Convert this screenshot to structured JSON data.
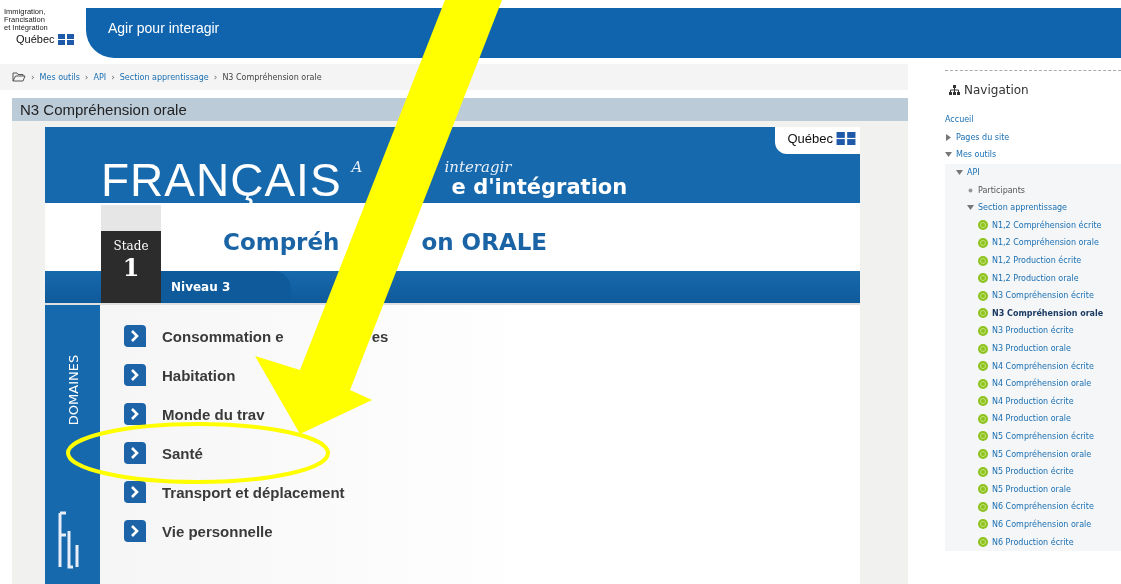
{
  "header": {
    "logo_lines": [
      "Immigration,",
      "Francisation",
      "et Intégration"
    ],
    "logo_name": "Québec",
    "site_title": "Agir pour interagir"
  },
  "breadcrumb": {
    "separator": "›",
    "items": [
      "Mes outils",
      "API",
      "Section apprentissage",
      "N3 Compréhension orale"
    ]
  },
  "page_title": "N3 Compréhension orale",
  "course_image": {
    "brand": "Québec",
    "title": "FRANÇAIS",
    "script_a": "A",
    "script_b": "interagir",
    "subtitle_tail": "e d'intégration",
    "stade_label": "Stade",
    "stade_number": "1",
    "niveau": "Niveau 3",
    "heading_a": "Compréh",
    "heading_b": "on ORALE",
    "side_label": "DOMAINES",
    "domains": [
      {
        "label": "Consommation e",
        "tail": "es"
      },
      {
        "label": "Habitation"
      },
      {
        "label": "Monde du trav"
      },
      {
        "label": "Santé"
      },
      {
        "label": "Transport et déplacement"
      },
      {
        "label": "Vie personnelle"
      }
    ]
  },
  "navigation": {
    "title": "Navigation",
    "items": [
      {
        "label": "Accueil",
        "kind": "plain"
      },
      {
        "label": "Pages du site",
        "kind": "branch",
        "expanded": false
      },
      {
        "label": "Mes outils",
        "kind": "branch",
        "expanded": true,
        "children": [
          {
            "label": "API",
            "kind": "branch",
            "expanded": true,
            "children": [
              {
                "label": "Participants",
                "kind": "bullet"
              },
              {
                "label": "Section apprentissage",
                "kind": "branch",
                "expanded": true,
                "children": [
                  {
                    "label": "N1,2 Compréhension écrite",
                    "kind": "activity",
                    "selected": false
                  },
                  {
                    "label": "N1,2 Compréhension orale",
                    "kind": "activity",
                    "selected": false
                  },
                  {
                    "label": "N1,2 Production écrite",
                    "kind": "activity",
                    "selected": false
                  },
                  {
                    "label": "N1,2 Production orale",
                    "kind": "activity",
                    "selected": false
                  },
                  {
                    "label": "N3 Compréhension écrite",
                    "kind": "activity",
                    "selected": false
                  },
                  {
                    "label": "N3 Compréhension orale",
                    "kind": "activity",
                    "selected": true
                  },
                  {
                    "label": "N3 Production écrite",
                    "kind": "activity",
                    "selected": false
                  },
                  {
                    "label": "N3 Production orale",
                    "kind": "activity",
                    "selected": false
                  },
                  {
                    "label": "N4 Compréhension écrite",
                    "kind": "activity",
                    "selected": false
                  },
                  {
                    "label": "N4 Compréhension orale",
                    "kind": "activity",
                    "selected": false
                  },
                  {
                    "label": "N4 Production écrite",
                    "kind": "activity",
                    "selected": false
                  },
                  {
                    "label": "N4 Production orale",
                    "kind": "activity",
                    "selected": false
                  },
                  {
                    "label": "N5 Compréhension écrite",
                    "kind": "activity",
                    "selected": false
                  },
                  {
                    "label": "N5 Compréhension orale",
                    "kind": "activity",
                    "selected": false
                  },
                  {
                    "label": "N5 Production écrite",
                    "kind": "activity",
                    "selected": false
                  },
                  {
                    "label": "N5 Production orale",
                    "kind": "activity",
                    "selected": false
                  },
                  {
                    "label": "N6 Compréhension écrite",
                    "kind": "activity",
                    "selected": false
                  },
                  {
                    "label": "N6 Compréhension orale",
                    "kind": "activity",
                    "selected": false
                  },
                  {
                    "label": "N6 Production écrite",
                    "kind": "activity",
                    "selected": false
                  }
                ]
              }
            ]
          }
        ]
      }
    ]
  }
}
